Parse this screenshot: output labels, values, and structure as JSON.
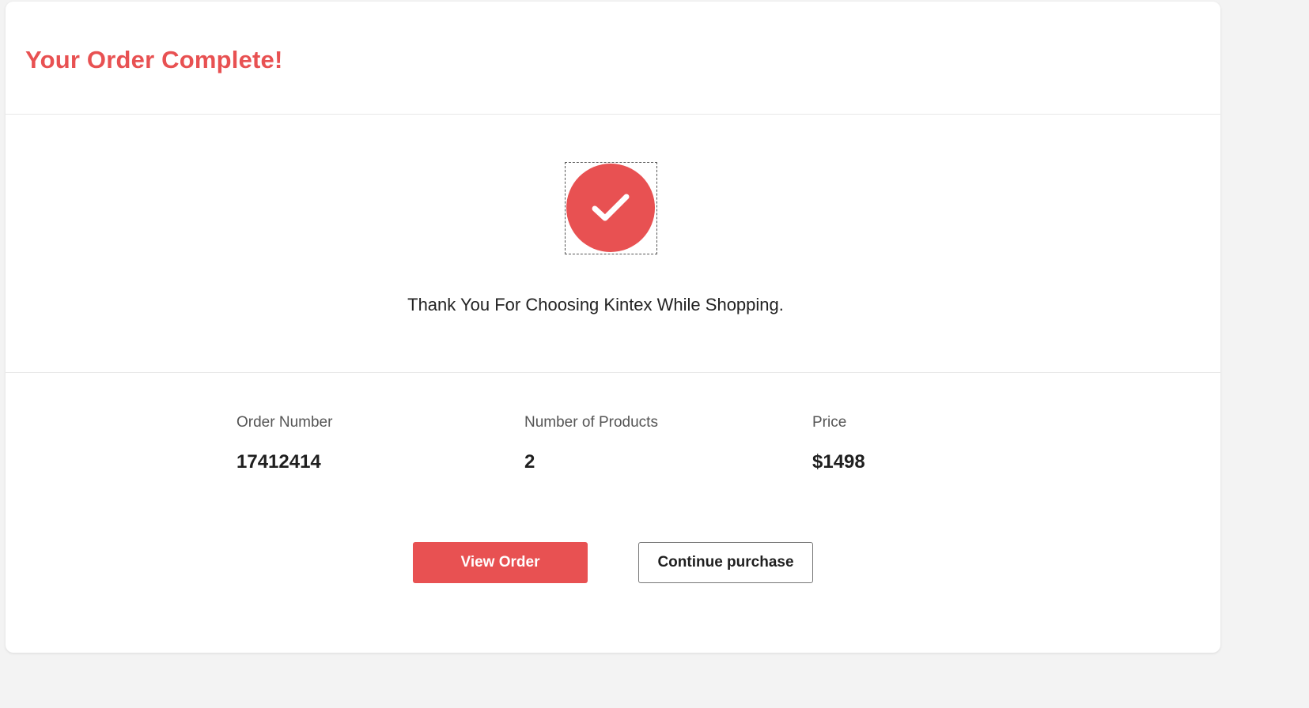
{
  "header": {
    "title": "Your Order Complete!"
  },
  "confirmation": {
    "icon": "check-circle-icon",
    "message": "Thank You For Choosing Kintex While Shopping."
  },
  "order_details": [
    {
      "label": "Order Number",
      "value": "17412414"
    },
    {
      "label": "Number of Products",
      "value": "2"
    },
    {
      "label": "Price",
      "value": "$1498"
    }
  ],
  "actions": {
    "view_order_label": "View Order",
    "continue_label": "Continue purchase"
  },
  "colors": {
    "accent": "#e85152",
    "background": "#f3f3f3",
    "card": "#ffffff"
  }
}
